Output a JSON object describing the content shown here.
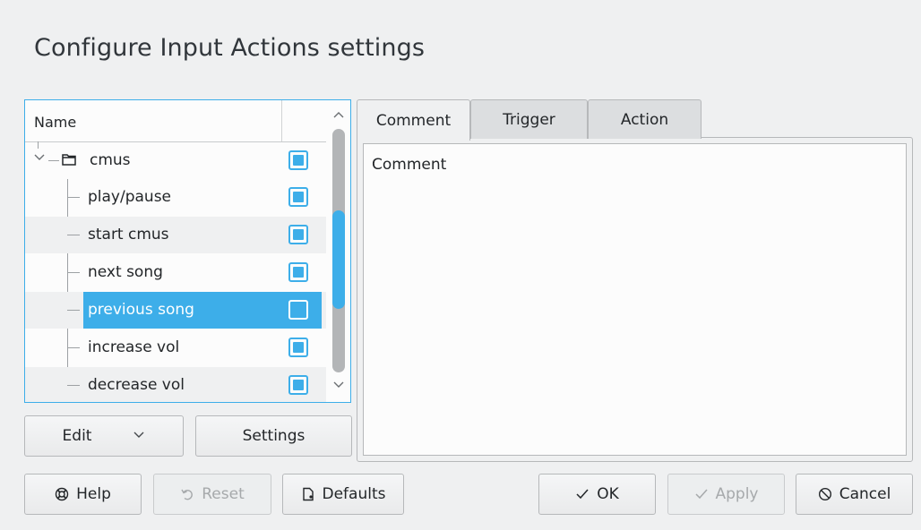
{
  "window": {
    "title": "Configure Input Actions settings"
  },
  "tree": {
    "column_name": "Name",
    "group": {
      "label": "cmus",
      "checked": true,
      "expanded": true
    },
    "items": [
      {
        "label": "play/pause",
        "checked": true,
        "selected": false
      },
      {
        "label": "start cmus",
        "checked": true,
        "selected": false
      },
      {
        "label": "next song",
        "checked": true,
        "selected": false
      },
      {
        "label": "previous song",
        "checked": false,
        "selected": true
      },
      {
        "label": "increase vol",
        "checked": true,
        "selected": false
      },
      {
        "label": "decrease vol",
        "checked": true,
        "selected": false
      }
    ]
  },
  "left_buttons": {
    "edit": "Edit",
    "settings": "Settings"
  },
  "tabs": [
    {
      "label": "Comment",
      "active": true
    },
    {
      "label": "Trigger",
      "active": false
    },
    {
      "label": "Action",
      "active": false
    }
  ],
  "comment_panel": {
    "text": "Comment"
  },
  "footer": {
    "help": "Help",
    "reset": "Reset",
    "defaults": "Defaults",
    "ok": "OK",
    "apply": "Apply",
    "cancel": "Cancel"
  },
  "colors": {
    "accent": "#3daee9",
    "window_bg": "#eff0f1",
    "view_bg": "#fcfcfc"
  }
}
